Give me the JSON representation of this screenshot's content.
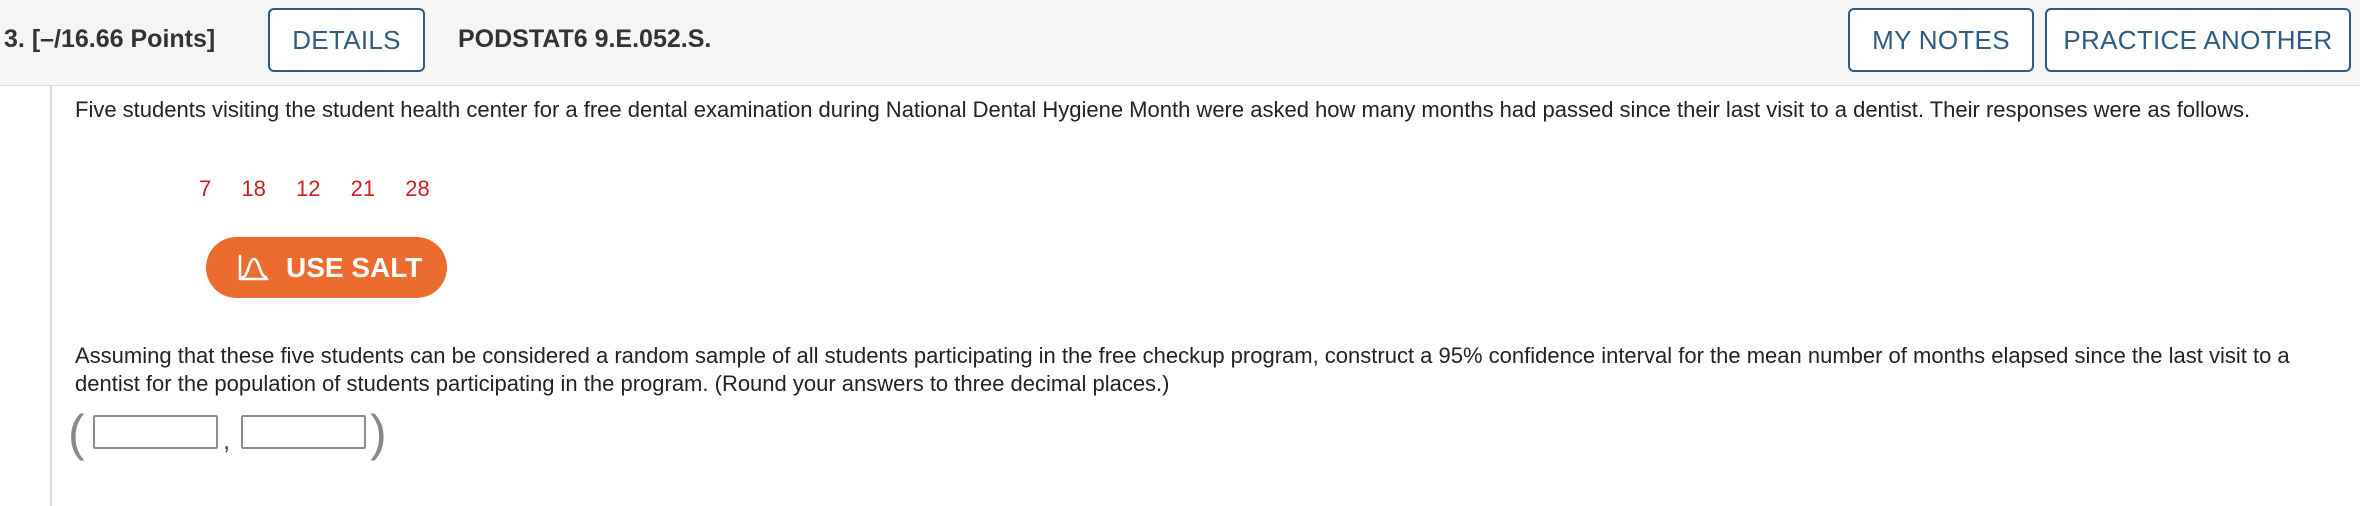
{
  "header": {
    "question_number": "3.",
    "points": "[–/16.66 Points]",
    "details_label": "DETAILS",
    "question_code": "PODSTAT6 9.E.052.S.",
    "my_notes_label": "MY NOTES",
    "practice_another_label": "PRACTICE ANOTHER"
  },
  "problem": {
    "intro": "Five students visiting the student health center for a free dental examination during National Dental Hygiene Month were asked how many months had passed since their last visit to a dentist. Their responses were as follows.",
    "data_values": [
      "7",
      "18",
      "12",
      "21",
      "28"
    ],
    "salt_button_label": "USE SALT",
    "question": "Assuming that these five students can be considered a random sample of all students participating in the free checkup program, construct a 95% confidence interval for the mean number of months elapsed since the last visit to a dentist for the population of students participating in the program. (Round your answers to three decimal places.)",
    "answer": {
      "open_paren": "(",
      "separator": ",",
      "close_paren": ")",
      "lower_value": "",
      "upper_value": ""
    }
  },
  "colors": {
    "accent_blue": "#2d5b85",
    "data_red": "#cc1f1f",
    "salt_orange": "#ec6c2f",
    "header_bg": "#f5f5f5"
  },
  "icons": {
    "salt": "bell-curve-icon"
  }
}
